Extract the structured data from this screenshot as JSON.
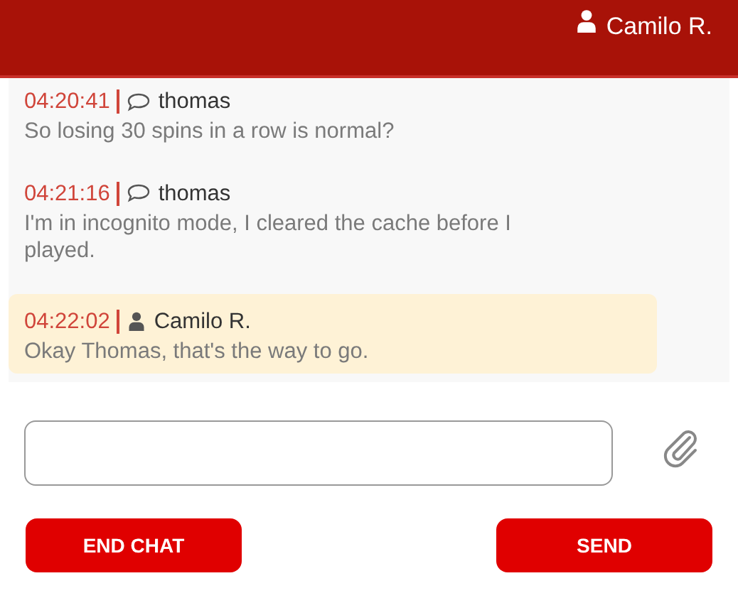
{
  "header": {
    "user": "Camilo R."
  },
  "messages": [
    {
      "kind": "customer",
      "time": "04:20:41",
      "author": "thomas",
      "text": "So losing 30 spins in a row is normal?"
    },
    {
      "kind": "customer",
      "time": "04:21:16",
      "author": "thomas",
      "text": "I'm in incognito mode, I cleared the cache before I played."
    },
    {
      "kind": "agent",
      "time": "04:22:02",
      "author": "Camilo R.",
      "text": "Okay Thomas, that's the way to go."
    }
  ],
  "buttons": [
    "END CHAT",
    "SEND"
  ]
}
